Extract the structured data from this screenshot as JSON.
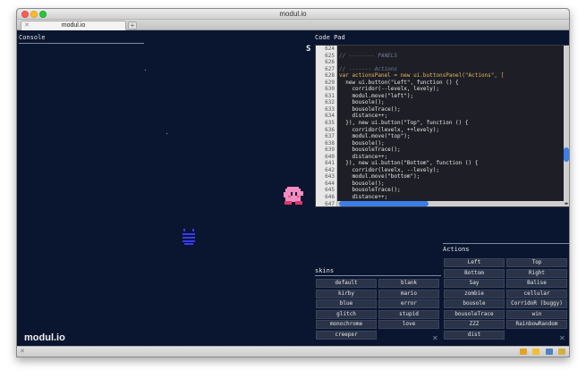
{
  "window": {
    "title": "modul.io",
    "tab_label": "modul.io",
    "tab_close": "✕",
    "new_tab": "+"
  },
  "console": {
    "title": "Console",
    "brand": "modul.io"
  },
  "game": {
    "score_char": "S"
  },
  "codepad": {
    "title": "Code Pad",
    "line_numbers": [
      "624",
      "625",
      "626",
      "627",
      "628",
      "629",
      "630",
      "631",
      "632",
      "633",
      "634",
      "635",
      "636",
      "637",
      "638",
      "639",
      "640",
      "641",
      "642",
      "643",
      "644",
      "645",
      "646",
      "647"
    ],
    "lines": [
      "",
      "// -------- PANELS",
      "",
      "// ------- Actions",
      "var actionsPanel = new ui.buttonsPanel(\"Actions\", [",
      "  new ui.button(\"Left\", function () {",
      "    corridor(--levelx, levely);",
      "    modul.move(\"left\");",
      "    bousole();",
      "    bousoleTrace();",
      "    distance++;",
      "  }), new ui.button(\"Top\", function () {",
      "    corridor(levelx, ++levely);",
      "    modul.move(\"top\");",
      "    bousole();",
      "    bousoleTrace();",
      "    distance++;",
      "  }), new ui.button(\"Bottom\", function () {",
      "    corridor(levelx, --levely);",
      "    modul.move(\"bottom\");",
      "    bousole();",
      "    bousoleTrace();",
      "    distance++;",
      ""
    ]
  },
  "actions": {
    "title": "Actions",
    "buttons": [
      "Left",
      "Top",
      "Bottom",
      "Right",
      "Say",
      "Balise",
      "zombie",
      "cellular",
      "bousole",
      "CorridoR (buggy)",
      "bousoleTrace",
      "win",
      "ZZZ",
      "RainbowRandom",
      "dist"
    ]
  },
  "skins": {
    "title": "skins",
    "buttons": [
      "default",
      "blank",
      "kirby",
      "mario",
      "blue",
      "error",
      "glitch",
      "stupid",
      "monochrome",
      "love",
      "creeper"
    ]
  },
  "close_symbol": "✕",
  "statusbar": {
    "left": "✕"
  },
  "colors": {
    "background": "#0a1530",
    "button": "#2a3347",
    "accent": "#3b7ee6"
  }
}
